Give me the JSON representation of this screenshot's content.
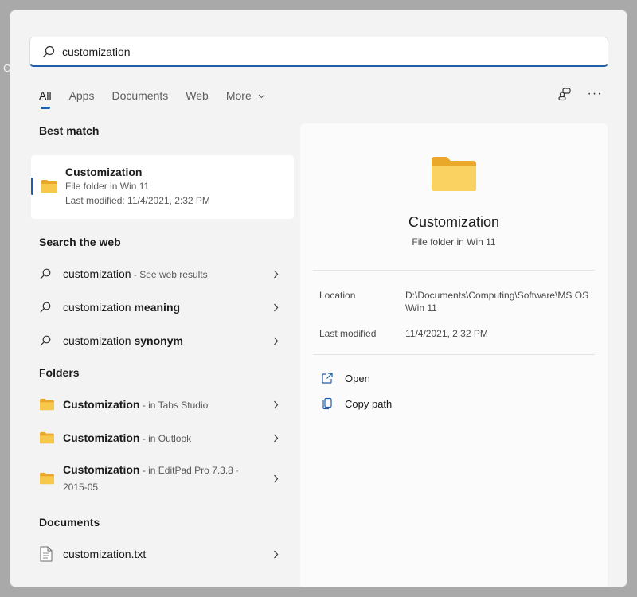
{
  "background_letter": "C",
  "search": {
    "value": "customization",
    "icon": "search-icon"
  },
  "tabs": [
    {
      "label": "All",
      "active": true
    },
    {
      "label": "Apps"
    },
    {
      "label": "Documents"
    },
    {
      "label": "Web"
    },
    {
      "label": "More"
    }
  ],
  "toolbar": {
    "icons": [
      "account-switch-icon",
      "more-options-icon"
    ],
    "more_glyph": "···"
  },
  "best_match": {
    "heading": "Best match",
    "name": "Customization",
    "type": "File folder in Win 11",
    "modified": "Last modified: 11/4/2021, 2:32 PM"
  },
  "web": {
    "heading": "Search the web",
    "items": [
      {
        "query": "customization",
        "suffix": " - See web results"
      },
      {
        "query": "customization ",
        "bold": "meaning"
      },
      {
        "query": "customization ",
        "bold": "synonym"
      }
    ]
  },
  "folders": {
    "heading": "Folders",
    "items": [
      {
        "name": "Customization",
        "location": " - in Tabs Studio"
      },
      {
        "name": "Customization",
        "location": " - in Outlook"
      },
      {
        "name": "Customization",
        "location": " - in EditPad Pro 7.3.8 ·",
        "location_line2": "2015-05"
      }
    ]
  },
  "documents": {
    "heading": "Documents",
    "items": [
      {
        "name": "customization.txt"
      }
    ]
  },
  "preview": {
    "title": "Customization",
    "subtitle": "File folder in Win 11",
    "location_label": "Location",
    "location_value": "D:\\Documents\\Computing\\Software\\MS OS\\Win 11",
    "modified_label": "Last modified",
    "modified_value": "11/4/2021, 2:32 PM",
    "actions": [
      {
        "label": "Open",
        "icon": "open-external-icon"
      },
      {
        "label": "Copy path",
        "icon": "copy-icon"
      }
    ]
  },
  "colors": {
    "accent": "#1f5ea8",
    "folder_yellow": "#f7c94b",
    "panel": "#f3f3f3"
  }
}
